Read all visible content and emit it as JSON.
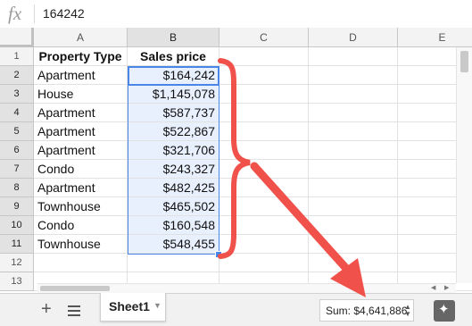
{
  "formula_bar": {
    "fx_label": "fx",
    "value": "164242"
  },
  "columns": [
    "A",
    "B",
    "C",
    "D",
    "E"
  ],
  "rows": [
    "1",
    "2",
    "3",
    "4",
    "5",
    "6",
    "7",
    "8",
    "9",
    "10",
    "11",
    "12",
    "13"
  ],
  "table": {
    "headers": [
      "Property Type",
      "Sales price"
    ],
    "data": [
      [
        "Apartment",
        "$164,242"
      ],
      [
        "House",
        "$1,145,078"
      ],
      [
        "Apartment",
        "$587,737"
      ],
      [
        "Apartment",
        "$522,867"
      ],
      [
        "Apartment",
        "$321,706"
      ],
      [
        "Condo",
        "$243,327"
      ],
      [
        "Apartment",
        "$482,425"
      ],
      [
        "Townhouse",
        "$465,502"
      ],
      [
        "Condo",
        "$160,548"
      ],
      [
        "Townhouse",
        "$548,455"
      ]
    ]
  },
  "footer": {
    "add_sheet_label": "+",
    "sheet_tab": "Sheet1",
    "sum_label": "Sum: $4,641,886",
    "sum_arrows": "▲▼"
  },
  "colors": {
    "accent": "#4a86e8",
    "annotation": "#f0524b",
    "selection_fill": "#e8f0fe"
  }
}
